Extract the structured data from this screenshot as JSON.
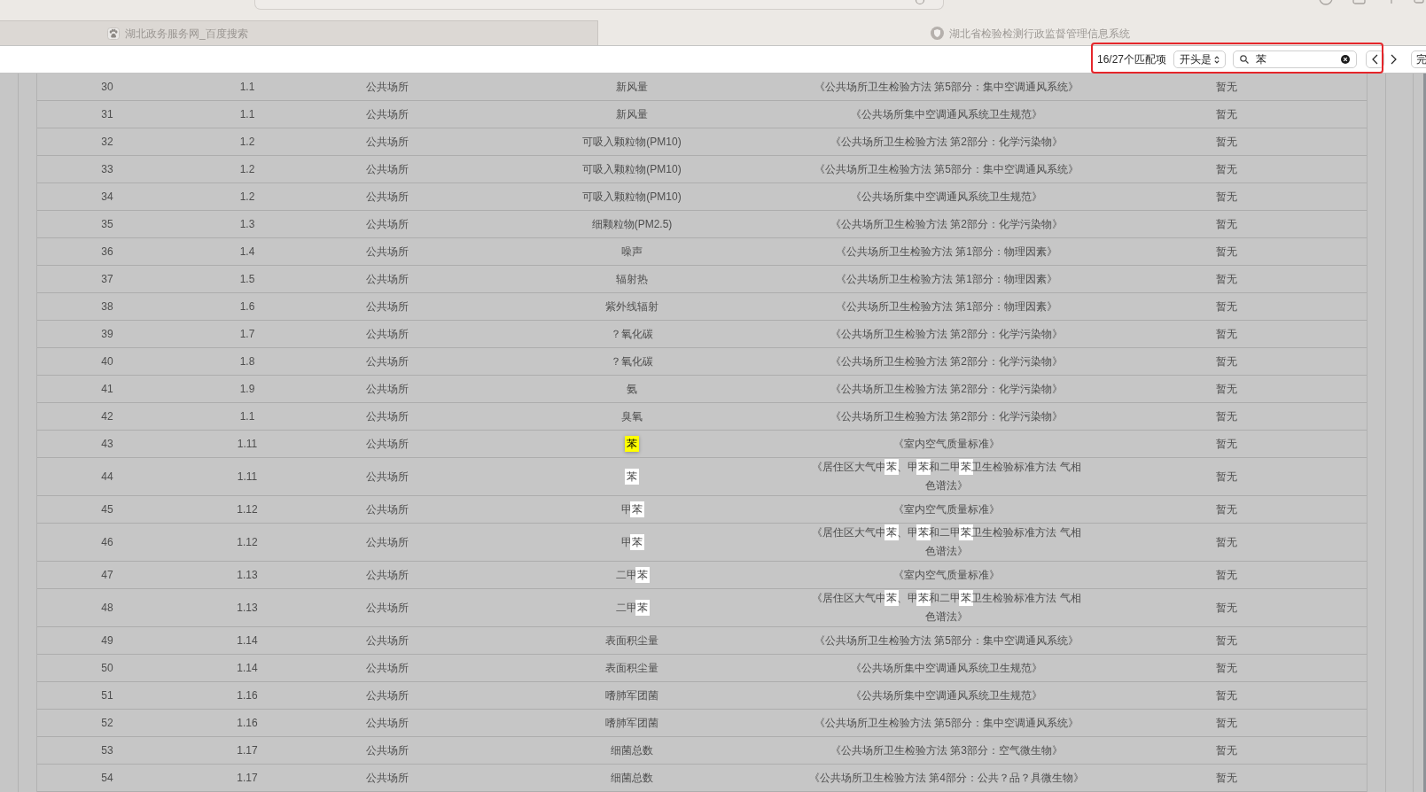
{
  "tabs": [
    {
      "title": "湖北政务服务网_百度搜索",
      "selected": false
    },
    {
      "title": "湖北省检验检测行政监督管理信息系统",
      "selected": true
    }
  ],
  "find_bar": {
    "match_count": "16/27个匹配项",
    "mode": "开头是",
    "query": "苯",
    "done_button": "完"
  },
  "table": {
    "rows": [
      {
        "cells": [
          "30",
          "1.1",
          "公共场所",
          "新风量",
          "《公共场所卫生检验方法 第5部分：集中空调通风系统》",
          "暂无"
        ]
      },
      {
        "cells": [
          "31",
          "1.1",
          "公共场所",
          "新风量",
          "《公共场所集中空调通风系统卫生规范》",
          "暂无"
        ]
      },
      {
        "cells": [
          "32",
          "1.2",
          "公共场所",
          "可吸入颗粒物(PM10)",
          "《公共场所卫生检验方法 第2部分：化学污染物》",
          "暂无"
        ]
      },
      {
        "cells": [
          "33",
          "1.2",
          "公共场所",
          "可吸入颗粒物(PM10)",
          "《公共场所卫生检验方法 第5部分：集中空调通风系统》",
          "暂无"
        ]
      },
      {
        "cells": [
          "34",
          "1.2",
          "公共场所",
          "可吸入颗粒物(PM10)",
          "《公共场所集中空调通风系统卫生规范》",
          "暂无"
        ]
      },
      {
        "cells": [
          "35",
          "1.3",
          "公共场所",
          "细颗粒物(PM2.5)",
          "《公共场所卫生检验方法 第2部分：化学污染物》",
          "暂无"
        ]
      },
      {
        "cells": [
          "36",
          "1.4",
          "公共场所",
          "噪声",
          "《公共场所卫生检验方法 第1部分：物理因素》",
          "暂无"
        ]
      },
      {
        "cells": [
          "37",
          "1.5",
          "公共场所",
          "辐射热",
          "《公共场所卫生检验方法 第1部分：物理因素》",
          "暂无"
        ]
      },
      {
        "cells": [
          "38",
          "1.6",
          "公共场所",
          "紫外线辐射",
          "《公共场所卫生检验方法 第1部分：物理因素》",
          "暂无"
        ]
      },
      {
        "cells": [
          "39",
          "1.7",
          "公共场所",
          "？氧化碳",
          "《公共场所卫生检验方法 第2部分：化学污染物》",
          "暂无"
        ]
      },
      {
        "cells": [
          "40",
          "1.8",
          "公共场所",
          "？氧化碳",
          "《公共场所卫生检验方法 第2部分：化学污染物》",
          "暂无"
        ]
      },
      {
        "cells": [
          "41",
          "1.9",
          "公共场所",
          "氨",
          "《公共场所卫生检验方法 第2部分：化学污染物》",
          "暂无"
        ]
      },
      {
        "cells": [
          "42",
          "1.1",
          "公共场所",
          "臭氧",
          "《公共场所卫生检验方法 第2部分：化学污染物》",
          "暂无"
        ]
      },
      {
        "cells": [
          "43",
          "1.11",
          "公共场所",
          {
            "parts": [
              {
                "text": "苯",
                "match": true,
                "current": true
              }
            ]
          },
          "《室内空气质量标准》",
          "暂无"
        ]
      },
      {
        "cells": [
          "44",
          "1.11",
          "公共场所",
          {
            "parts": [
              {
                "text": "苯",
                "match": true,
                "current": false
              }
            ]
          },
          {
            "parts": [
              {
                "text": "《居住区大气中",
                "match": false,
                "current": false
              },
              {
                "text": "苯",
                "match": true,
                "current": false
              },
              {
                "text": "、甲",
                "match": false,
                "current": false
              },
              {
                "text": "苯",
                "match": true,
                "current": false
              },
              {
                "text": "和二甲",
                "match": false,
                "current": false
              },
              {
                "text": "苯",
                "match": true,
                "current": false
              },
              {
                "text": "卫生检验标准方法 气相色谱法》",
                "match": false,
                "current": false
              }
            ]
          },
          "暂无"
        ]
      },
      {
        "cells": [
          "45",
          "1.12",
          "公共场所",
          {
            "parts": [
              {
                "text": "甲",
                "match": false,
                "current": false
              },
              {
                "text": "苯",
                "match": true,
                "current": false
              }
            ]
          },
          "《室内空气质量标准》",
          "暂无"
        ]
      },
      {
        "cells": [
          "46",
          "1.12",
          "公共场所",
          {
            "parts": [
              {
                "text": "甲",
                "match": false,
                "current": false
              },
              {
                "text": "苯",
                "match": true,
                "current": false
              }
            ]
          },
          {
            "parts": [
              {
                "text": "《居住区大气中",
                "match": false,
                "current": false
              },
              {
                "text": "苯",
                "match": true,
                "current": false
              },
              {
                "text": "、甲",
                "match": false,
                "current": false
              },
              {
                "text": "苯",
                "match": true,
                "current": false
              },
              {
                "text": "和二甲",
                "match": false,
                "current": false
              },
              {
                "text": "苯",
                "match": true,
                "current": false
              },
              {
                "text": "卫生检验标准方法 气相色谱法》",
                "match": false,
                "current": false
              }
            ]
          },
          "暂无"
        ]
      },
      {
        "cells": [
          "47",
          "1.13",
          "公共场所",
          {
            "parts": [
              {
                "text": "二甲",
                "match": false,
                "current": false
              },
              {
                "text": "苯",
                "match": true,
                "current": false
              }
            ]
          },
          "《室内空气质量标准》",
          "暂无"
        ]
      },
      {
        "cells": [
          "48",
          "1.13",
          "公共场所",
          {
            "parts": [
              {
                "text": "二甲",
                "match": false,
                "current": false
              },
              {
                "text": "苯",
                "match": true,
                "current": false
              }
            ]
          },
          {
            "parts": [
              {
                "text": "《居住区大气中",
                "match": false,
                "current": false
              },
              {
                "text": "苯",
                "match": true,
                "current": false
              },
              {
                "text": "、甲",
                "match": false,
                "current": false
              },
              {
                "text": "苯",
                "match": true,
                "current": false
              },
              {
                "text": "和二甲",
                "match": false,
                "current": false
              },
              {
                "text": "苯",
                "match": true,
                "current": false
              },
              {
                "text": "卫生检验标准方法 气相色谱法》",
                "match": false,
                "current": false
              }
            ]
          },
          "暂无"
        ]
      },
      {
        "cells": [
          "49",
          "1.14",
          "公共场所",
          "表面积尘量",
          "《公共场所卫生检验方法 第5部分：集中空调通风系统》",
          "暂无"
        ]
      },
      {
        "cells": [
          "50",
          "1.14",
          "公共场所",
          "表面积尘量",
          "《公共场所集中空调通风系统卫生规范》",
          "暂无"
        ]
      },
      {
        "cells": [
          "51",
          "1.16",
          "公共场所",
          "嗜肺军团菌",
          "《公共场所集中空调通风系统卫生规范》",
          "暂无"
        ]
      },
      {
        "cells": [
          "52",
          "1.16",
          "公共场所",
          "嗜肺军团菌",
          "《公共场所卫生检验方法 第5部分：集中空调通风系统》",
          "暂无"
        ]
      },
      {
        "cells": [
          "53",
          "1.17",
          "公共场所",
          "细菌总数",
          "《公共场所卫生检验方法 第3部分：空气微生物》",
          "暂无"
        ]
      },
      {
        "cells": [
          "54",
          "1.17",
          "公共场所",
          "细菌总数",
          "《公共场所卫生检验方法 第4部分：公共？品？具微生物》",
          "暂无"
        ]
      }
    ]
  }
}
